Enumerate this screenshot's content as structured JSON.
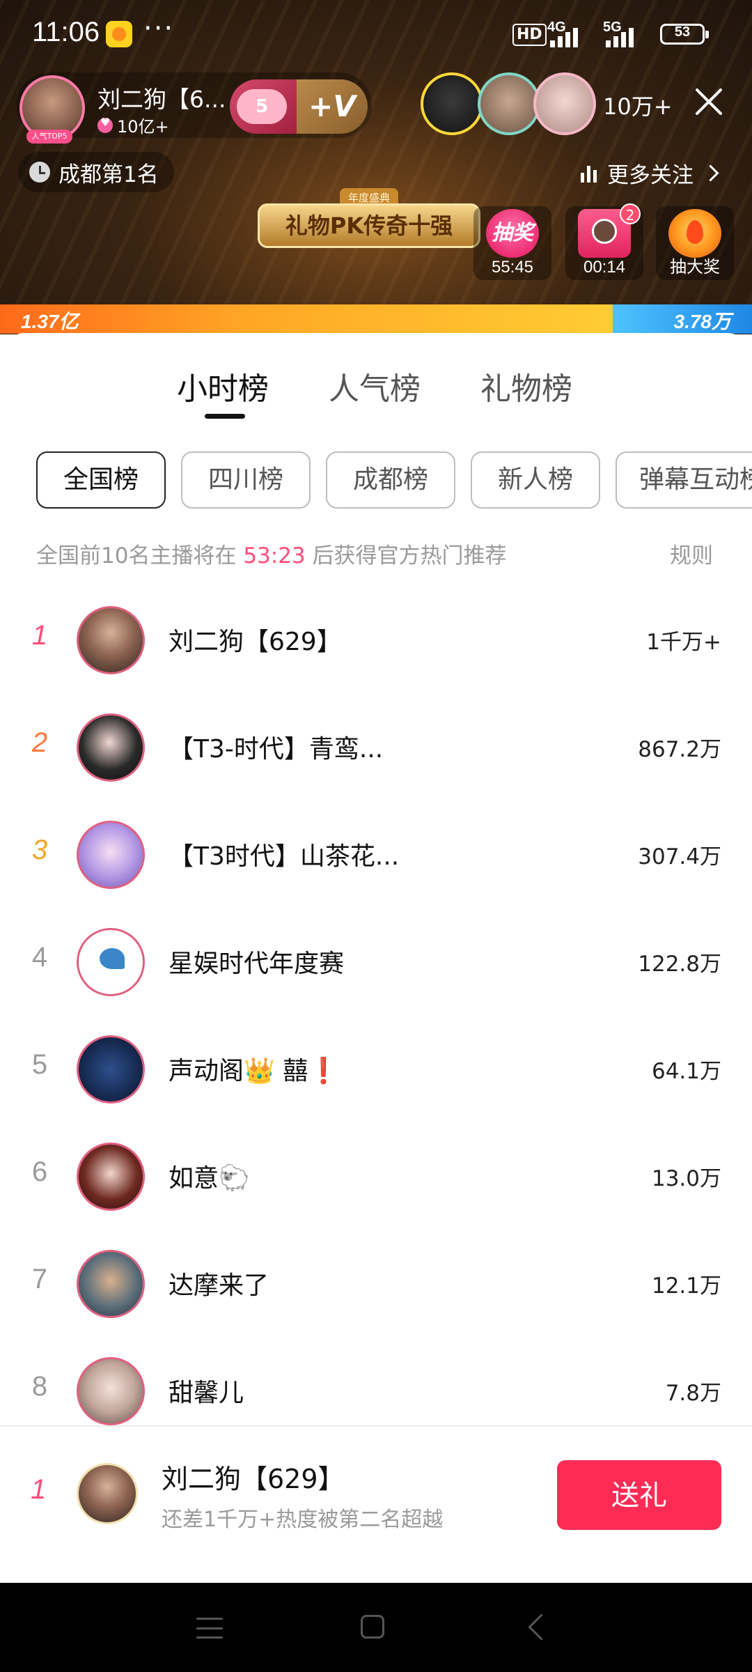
{
  "status_bar": {
    "time": "11:06",
    "more": "···",
    "hd": "HD",
    "net1": "4G",
    "net2": "5G",
    "battery": "53"
  },
  "host": {
    "name": "刘二狗【6...",
    "fans": "10亿+",
    "level": "5",
    "follow_label": "+V",
    "avatar_tag": "人气TOP5"
  },
  "audience": {
    "count": "10万+"
  },
  "location_rank": "成都第1名",
  "more_follow": "更多关注",
  "banner": {
    "top": "年度盛典",
    "title": "礼物PK传奇十强"
  },
  "activities": [
    {
      "icon": "lottery-icon",
      "icon_text": "抽奖",
      "label": "55:45"
    },
    {
      "icon": "gift-box-icon",
      "badge": "2",
      "label": "00:14"
    },
    {
      "icon": "big-prize-icon",
      "label": "抽大奖"
    }
  ],
  "pk": {
    "left_value": "1.37亿",
    "right_value": "3.78万",
    "left_share": 0.815,
    "left_color": "#ff8a1f",
    "right_color": "#2f9bf0"
  },
  "tabs": [
    {
      "label": "小时榜",
      "active": true
    },
    {
      "label": "人气榜",
      "active": false
    },
    {
      "label": "礼物榜",
      "active": false
    }
  ],
  "filters": [
    {
      "label": "全国榜",
      "active": true
    },
    {
      "label": "四川榜",
      "active": false
    },
    {
      "label": "成都榜",
      "active": false
    },
    {
      "label": "新人榜",
      "active": false
    },
    {
      "label": "弹幕互动榜",
      "active": false
    }
  ],
  "notice": {
    "prefix": "全国前10名主播将在",
    "countdown": "53:23",
    "suffix": "后获得官方热门推荐",
    "rules": "规则"
  },
  "rankings": [
    {
      "rank": "1",
      "name": "刘二狗【629】",
      "score": "1千万+"
    },
    {
      "rank": "2",
      "name": "【T3-时代】青鸾...",
      "score": "867.2万"
    },
    {
      "rank": "3",
      "name": "【T3时代】山茶花...",
      "score": "307.4万"
    },
    {
      "rank": "4",
      "name": "星娱时代年度赛",
      "score": "122.8万"
    },
    {
      "rank": "5",
      "name": "声动阁👑 囍❗",
      "score": "64.1万"
    },
    {
      "rank": "6",
      "name": "如意🐑",
      "score": "13.0万"
    },
    {
      "rank": "7",
      "name": "达摩来了",
      "score": "12.1万"
    },
    {
      "rank": "8",
      "name": "甜馨儿",
      "score": "7.8万"
    }
  ],
  "footer": {
    "rank": "1",
    "name": "刘二狗【629】",
    "subtitle": "还差1千万+热度被第二名超越",
    "gift_button": "送礼"
  },
  "colors": {
    "accent": "#fe2c55",
    "highlight": "#ff4c7a"
  }
}
